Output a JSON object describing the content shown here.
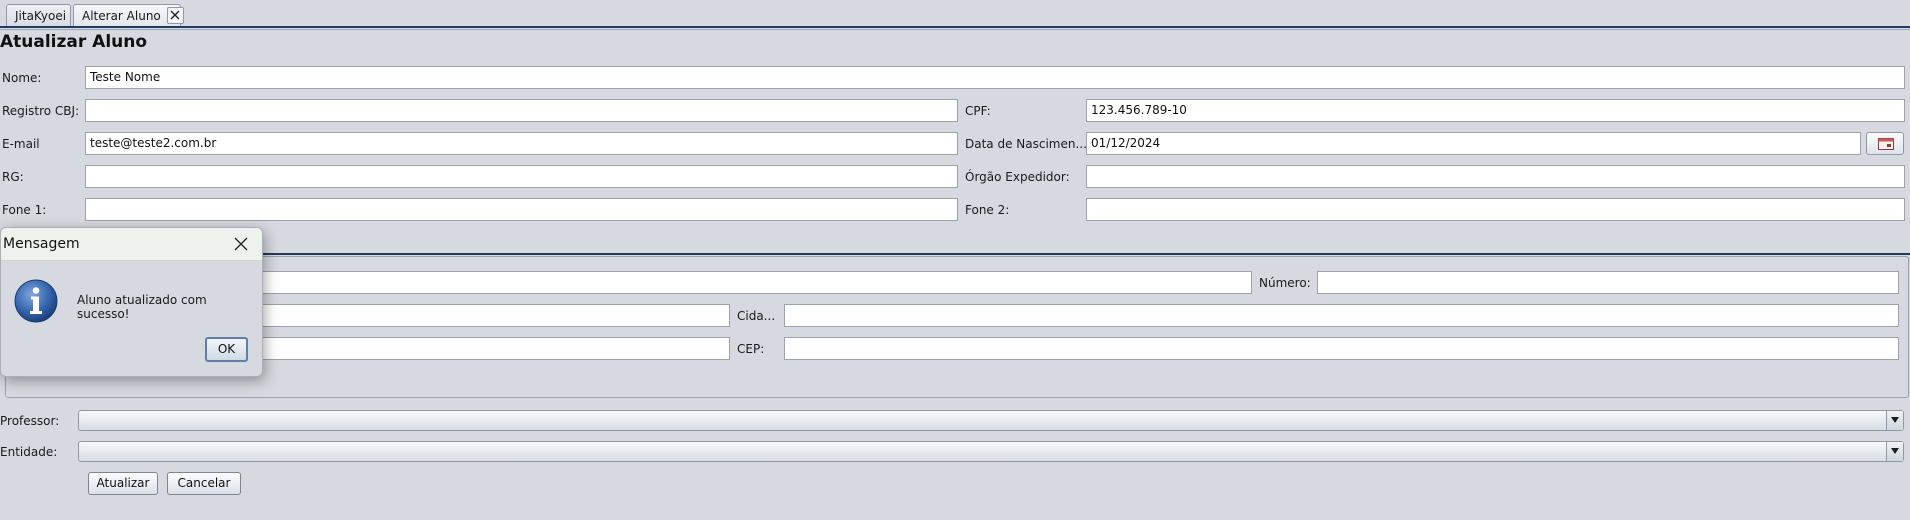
{
  "tabs": [
    {
      "label": "JitaKyoei"
    },
    {
      "label": "Alterar Aluno"
    }
  ],
  "page_title": "Atualizar Aluno",
  "form": {
    "nome": {
      "label": "Nome:",
      "value": "Teste Nome"
    },
    "registro_cbj": {
      "label": "Registro CBJ:",
      "value": ""
    },
    "cpf": {
      "label": "CPF:",
      "value": "123.456.789-10"
    },
    "email": {
      "label": "E-mail",
      "value": "teste@teste2.com.br"
    },
    "data_nascimento": {
      "label": "Data de Nascimen...",
      "value": "01/12/2024"
    },
    "rg": {
      "label": "RG:",
      "value": ""
    },
    "orgao_expedidor": {
      "label": "Órgão Expedidor:",
      "value": ""
    },
    "fone1": {
      "label": "Fone 1:",
      "value": ""
    },
    "fone2": {
      "label": "Fone 2:",
      "value": ""
    }
  },
  "address": {
    "rua": {
      "value": ""
    },
    "numero": {
      "label": "Número:",
      "value": ""
    },
    "bairro": {
      "value": ""
    },
    "cidade": {
      "label": "Cida...",
      "value": ""
    },
    "estado": {
      "value": ""
    },
    "cep": {
      "label": "CEP:",
      "value": ""
    }
  },
  "professor": {
    "label": "Professor:",
    "value": ""
  },
  "entidade": {
    "label": "Entidade:",
    "value": ""
  },
  "buttons": {
    "atualizar": "Atualizar",
    "cancelar": "Cancelar"
  },
  "dialog": {
    "title": "Mensagem",
    "message": "Aluno atualizado com sucesso!",
    "ok": "OK",
    "icon": "info-icon"
  },
  "colors": {
    "background": "#d6d9df",
    "tab_underline": "#23395f",
    "info_icon": "#2f5fa8"
  }
}
